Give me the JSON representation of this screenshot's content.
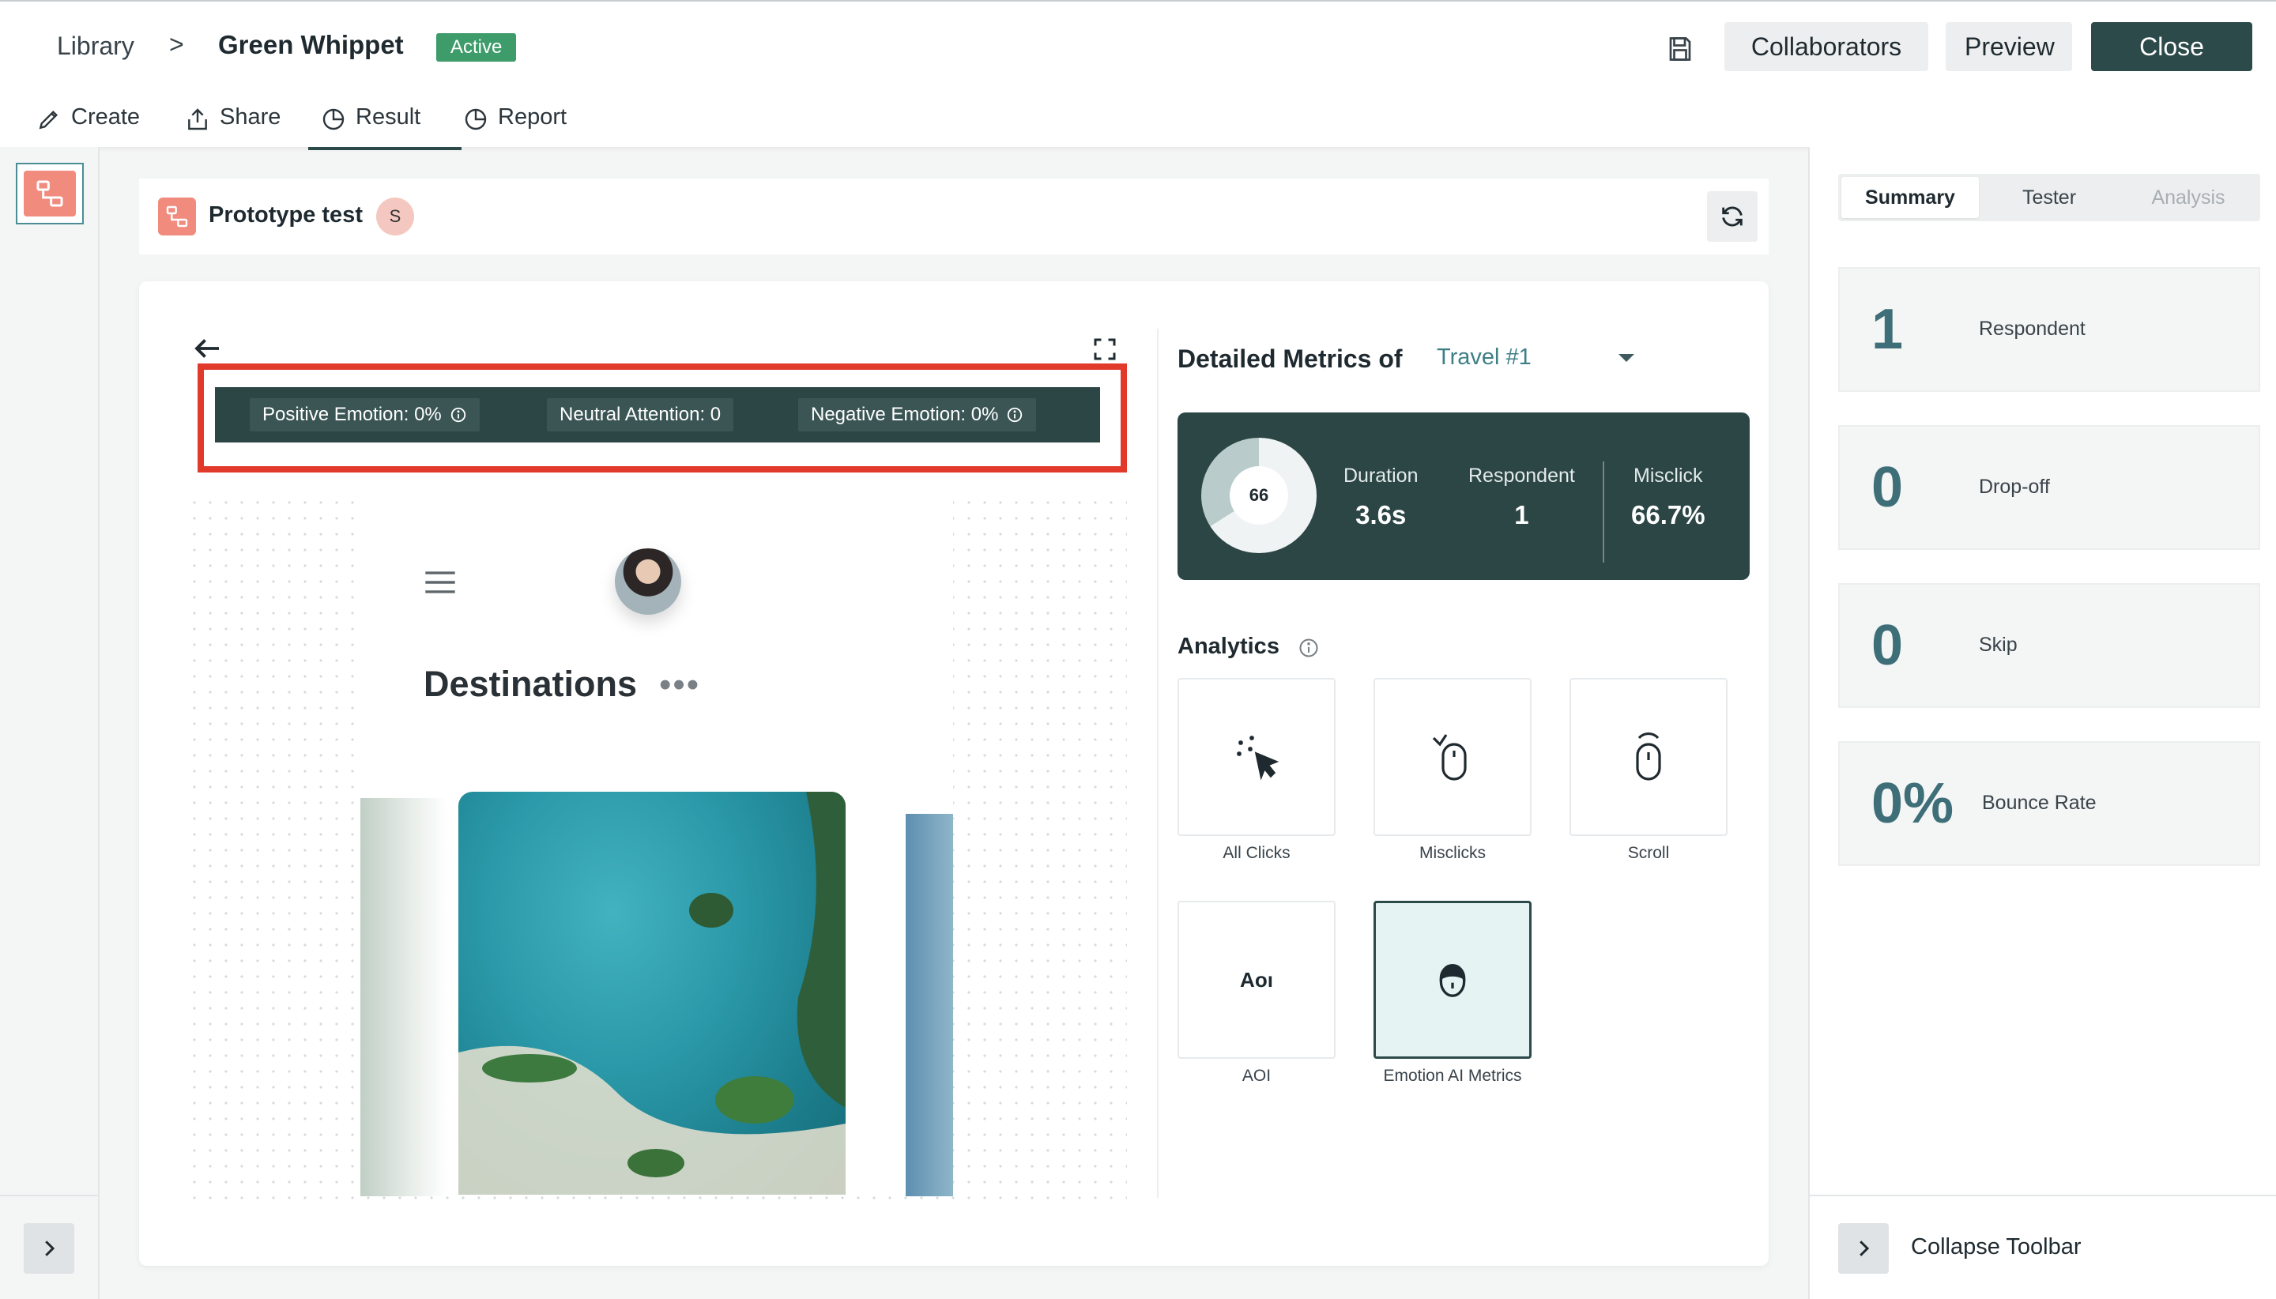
{
  "header": {
    "breadcrumb_root": "Library",
    "breadcrumb_sep": ">",
    "project_name": "Green Whippet",
    "status": "Active",
    "collaborators_label": "Collaborators",
    "preview_label": "Preview",
    "close_label": "Close"
  },
  "tabs": [
    {
      "label": "Create",
      "icon": "pencil-icon"
    },
    {
      "label": "Share",
      "icon": "share-icon"
    },
    {
      "label": "Result",
      "icon": "pie-chart-icon"
    },
    {
      "label": "Report",
      "icon": "pie-chart-icon"
    }
  ],
  "active_tab": "Result",
  "prototype": {
    "title": "Prototype test",
    "avatar_initial": "S"
  },
  "emotion_bar": {
    "positive": "Positive Emotion:  0%",
    "neutral": "Neutral Attention:  0",
    "negative": "Negative Emotion:  0%"
  },
  "prototype_screen": {
    "heading": "Destinations",
    "more": "•••"
  },
  "metrics": {
    "title": "Detailed Metrics of",
    "selected": "Travel #1",
    "donut_value": "66",
    "duration_label": "Duration",
    "duration_value": "3.6s",
    "respondent_label": "Respondent",
    "respondent_value": "1",
    "misclick_label": "Misclick",
    "misclick_value": "66.7%"
  },
  "analytics": {
    "title": "Analytics",
    "tiles": [
      {
        "label": "All Clicks",
        "icon": "all-clicks-icon"
      },
      {
        "label": "Misclicks",
        "icon": "misclicks-icon"
      },
      {
        "label": "Scroll",
        "icon": "scroll-icon"
      },
      {
        "label": "AOI",
        "icon": "aoi-icon",
        "glyph": "Aoı"
      },
      {
        "label": "Emotion AI Metrics",
        "icon": "emotion-icon"
      }
    ],
    "active_tile": "Emotion AI Metrics"
  },
  "sidebar": {
    "tabs": [
      "Summary",
      "Tester",
      "Analysis"
    ],
    "active_tab": "Summary",
    "stats": [
      {
        "value": "1",
        "label": "Respondent"
      },
      {
        "value": "0",
        "label": "Drop-off"
      },
      {
        "value": "0",
        "label": "Skip"
      },
      {
        "value": "0%",
        "label": "Bounce Rate"
      }
    ],
    "collapse_label": "Collapse Toolbar"
  },
  "colors": {
    "primary_dark": "#2d4a4a",
    "active_badge": "#3e9b6a",
    "highlight_border": "#e13a2a",
    "accent_coral": "#f08b7e",
    "stat_number": "#3e6f78"
  }
}
